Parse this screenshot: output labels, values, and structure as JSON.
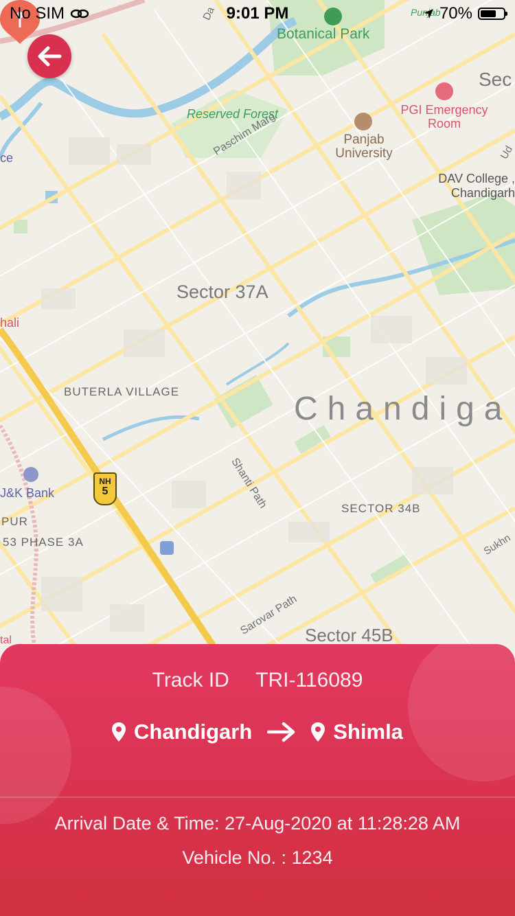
{
  "status_bar": {
    "carrier": "No SIM",
    "time": "9:01 PM",
    "battery_text": "70%",
    "battery_level": 0.7
  },
  "map": {
    "labels": {
      "botanical_park": "Botanical Park",
      "reserved_forest": "Reserved Forest",
      "paschim_marg": "Paschim Marg",
      "panjab_university": "Panjab University",
      "pgi_emergency": "PGI Emergency Room",
      "dav_college": "DAV College , Chandigarh",
      "sector_37a": "Sector 37A",
      "buterla_village": "BUTERLA VILLAGE",
      "chandigarh_big": "Chandiga",
      "shanti_path": "Shanti Path",
      "sector_34b": "SECTOR 34B",
      "jk_bank": "J&K Bank",
      "pur": "PUR",
      "phase_3a": "53 PHASE 3A",
      "nh_label": "NH",
      "nh_number": "5",
      "sarovar_path": "Sarovar Path",
      "sector_45b": "Sector 45B",
      "sec_partial": "Sec",
      "ce_partial": "ce",
      "hali_partial": "hali",
      "tal_partial": "tal",
      "sukhna_partial": "Sukhn",
      "ud_partial": "Ud",
      "da_partial": "Da",
      "punjab_partial": "Punjab"
    }
  },
  "tracking": {
    "track_id_label": "Track ID",
    "track_id_value": "TRI-116089",
    "from_city": "Chandigarh",
    "to_city": "Shimla",
    "arrival_label": "Arrival Date & Time:",
    "arrival_value": "27-Aug-2020 at 11:28:28 AM",
    "vehicle_label": "Vehicle No. :",
    "vehicle_value": "1234"
  },
  "colors": {
    "accent": "#d9304f",
    "sheet_top": "#e2385f",
    "sheet_bottom": "#d0303f",
    "map_bg": "#f2efe9",
    "park": "#cfe6c4",
    "water": "#9ccbe5",
    "highway": "#f5c94c",
    "road": "#fbe7a3"
  }
}
